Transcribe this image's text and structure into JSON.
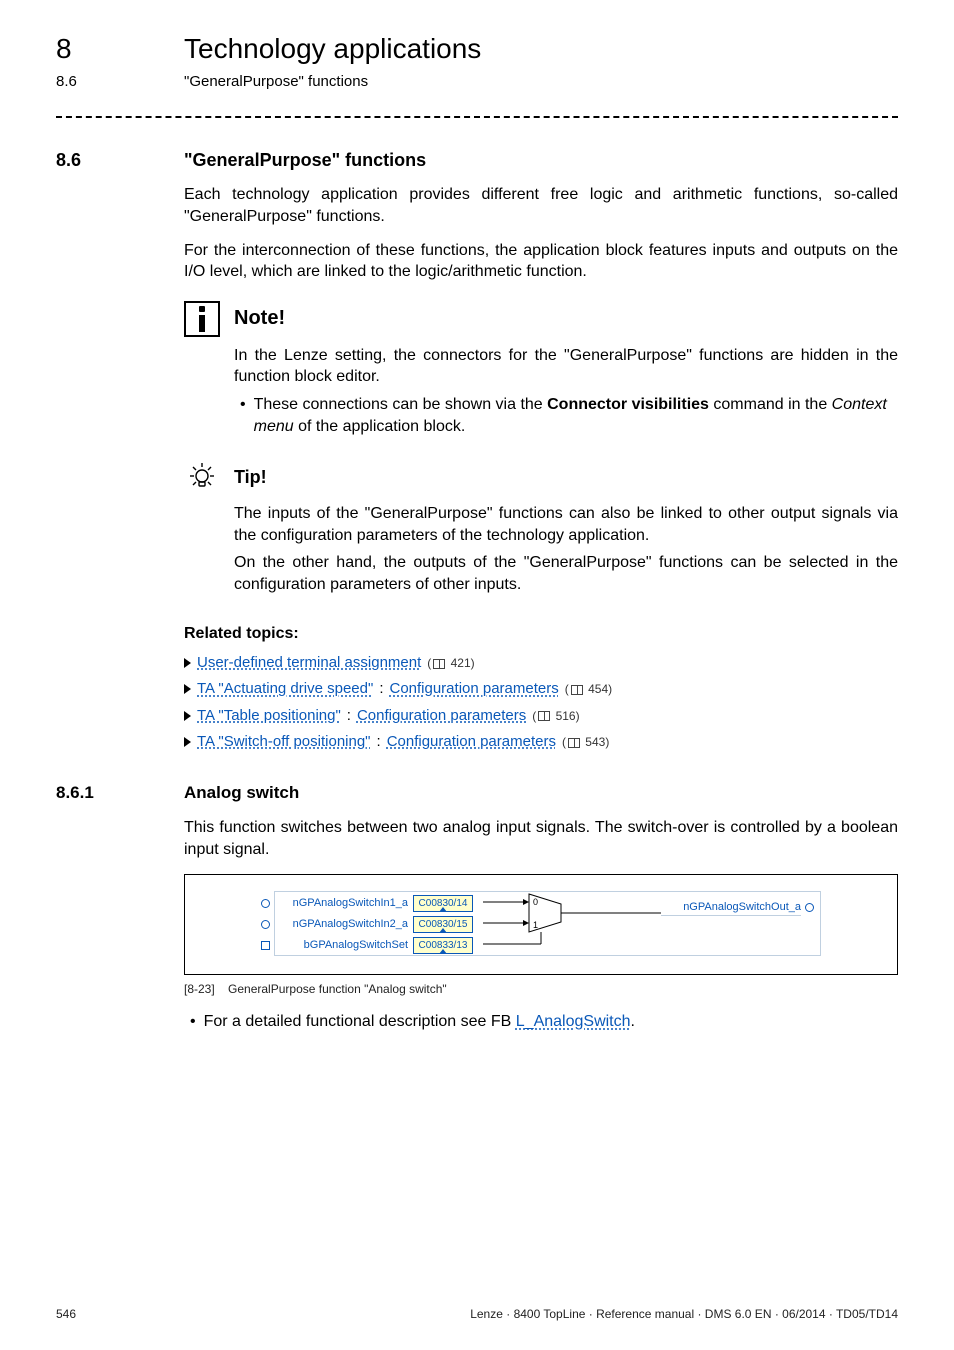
{
  "runhead": {
    "chnum": "8",
    "chtitle": "Technology applications",
    "secnum": "8.6",
    "sectitle": "\"GeneralPurpose\" functions"
  },
  "sec": {
    "num": "8.6",
    "title": "\"GeneralPurpose\" functions",
    "p1": "Each technology application provides different free logic and arithmetic functions, so-called \"GeneralPurpose\" functions.",
    "p2": "For the interconnection of these functions, the application block features inputs and outputs on the I/O level, which are linked to the logic/arithmetic function."
  },
  "note": {
    "title": "Note!",
    "body": "In the Lenze setting, the connectors for the \"GeneralPurpose\" functions are hidden in the function block editor.",
    "bullet_pre": "These connections can be shown via the ",
    "bullet_bold": "Connector visibilities",
    "bullet_mid": " command in the ",
    "bullet_ital": "Context menu",
    "bullet_post": " of the application block."
  },
  "tip": {
    "title": "Tip!",
    "p1": "The inputs of the \"GeneralPurpose\" functions can also be linked to other output signals via the configuration parameters of the technology application.",
    "p2": "On the other hand, the outputs of the \"GeneralPurpose\" functions can be selected in the configuration parameters of other inputs."
  },
  "related": {
    "title": "Related topics:",
    "items": [
      {
        "link": "User-defined terminal assignment",
        "page": "421"
      },
      {
        "link1": "TA \"Actuating drive speed\"",
        "sep": ": ",
        "link2": "Configuration parameters",
        "page": "454"
      },
      {
        "link1": "TA \"Table positioning\"",
        "sep": ": ",
        "link2": "Configuration parameters",
        "page": "516"
      },
      {
        "link1": "TA \"Switch-off positioning\"",
        "sep": ": ",
        "link2": "Configuration parameters",
        "page": "543"
      }
    ]
  },
  "subsec": {
    "num": "8.6.1",
    "title": "Analog switch",
    "p1": "This function switches between two analog input signals. The switch-over is controlled by a boolean input signal."
  },
  "fig": {
    "signals": {
      "in1": "nGPAnalogSwitchIn1_a",
      "in2": "nGPAnalogSwitchIn2_a",
      "set": "bGPAnalogSwitchSet",
      "out": "nGPAnalogSwitchOut_a"
    },
    "codes": {
      "in1": "C00830/14",
      "in2": "C00830/15",
      "set": "C00833/13"
    },
    "mux": {
      "zero": "0",
      "one": "1"
    },
    "caption_id": "[8-23]",
    "caption_text": "GeneralPurpose function \"Analog switch\""
  },
  "fb": {
    "pre": "For a detailed functional description see FB ",
    "link": "L_AnalogSwitch",
    "post": "."
  },
  "footer": {
    "page": "546",
    "doc": "Lenze · 8400 TopLine · Reference manual · DMS 6.0 EN · 06/2014 · TD05/TD14"
  }
}
